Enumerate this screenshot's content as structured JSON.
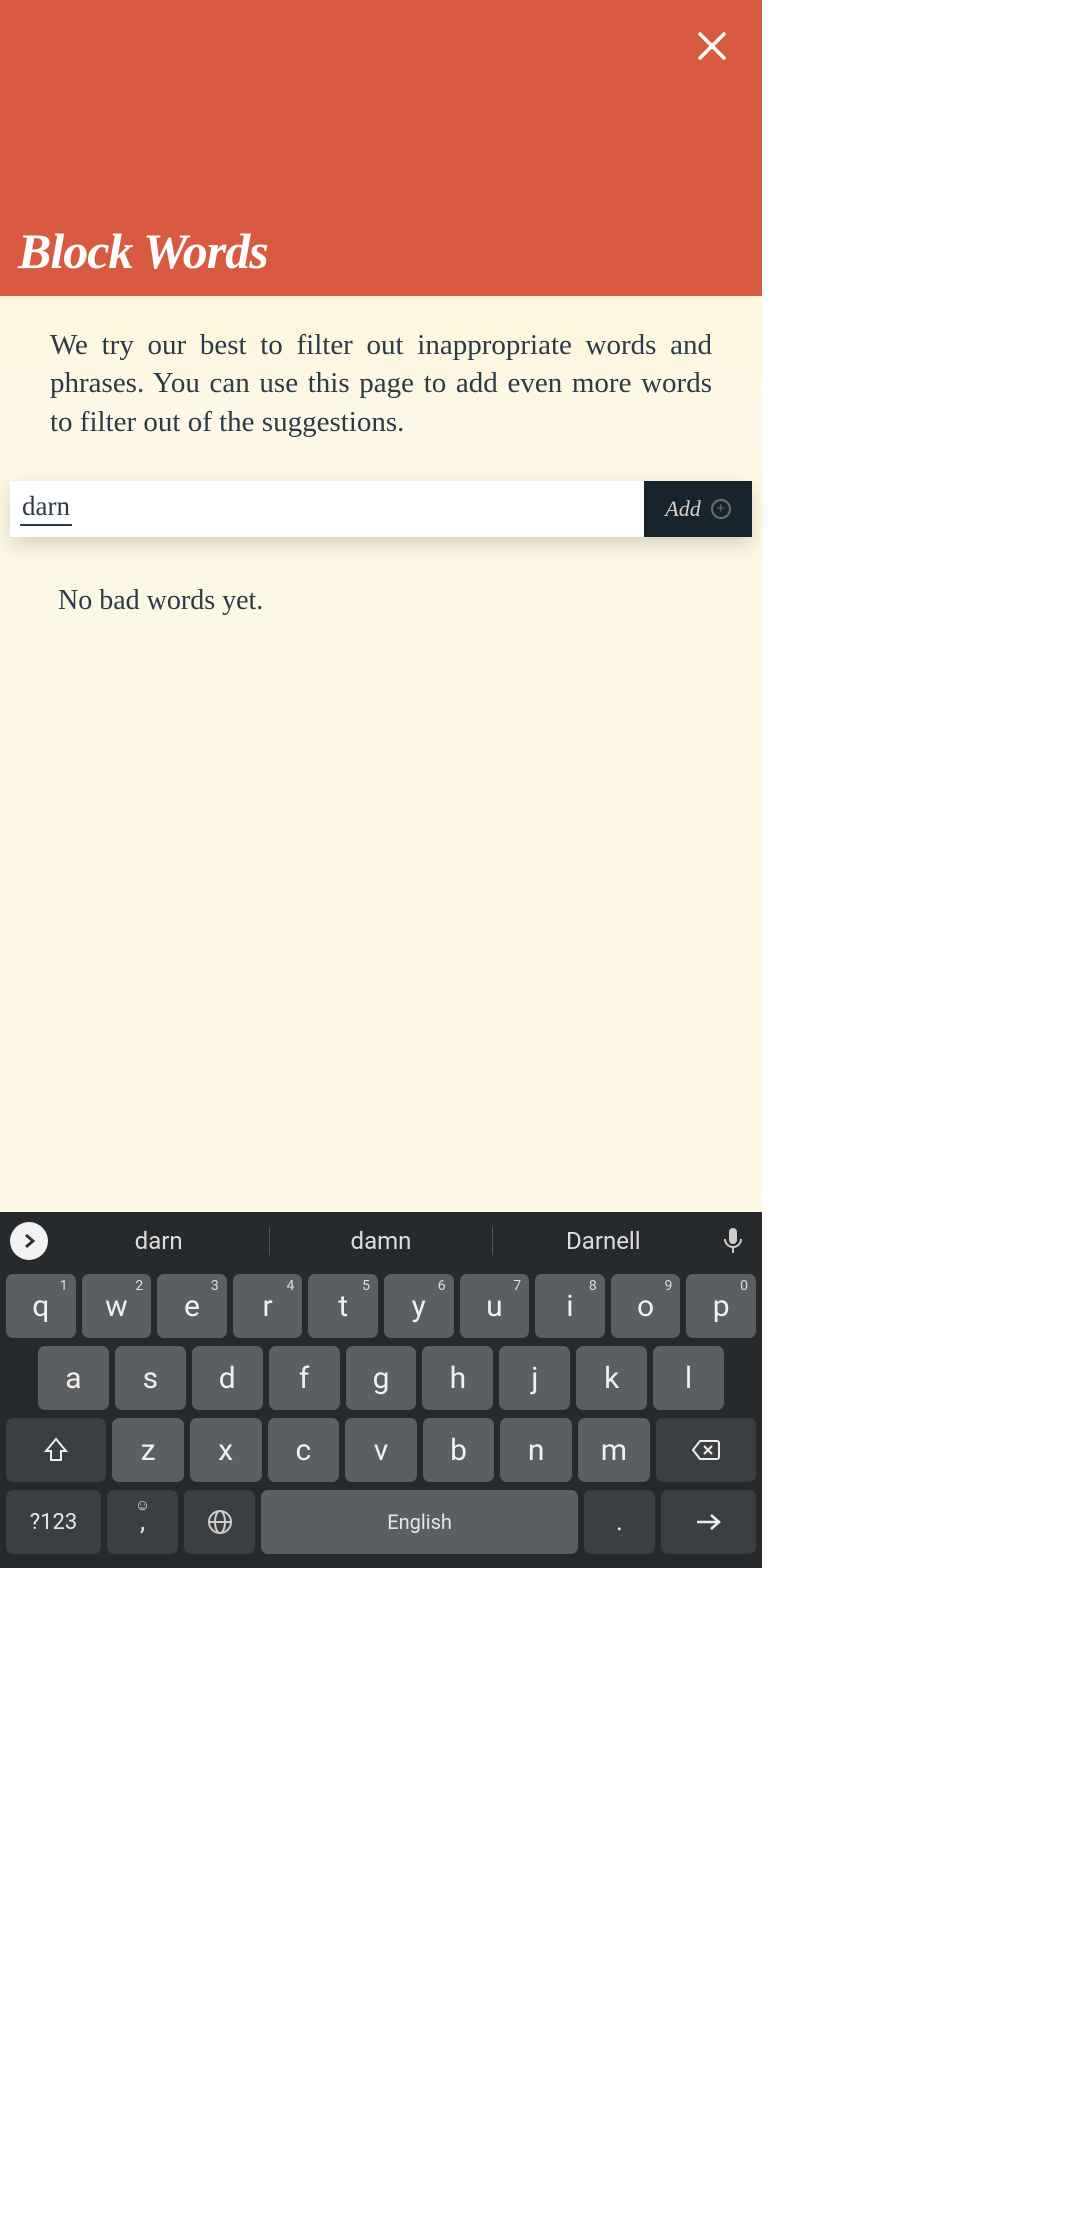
{
  "header": {
    "title": "Block Words"
  },
  "description": "We try our best to filter out inappropriate words and phrases. You can use this page to add even more words to filter out of the suggestions.",
  "input": {
    "value": "darn",
    "add_label": "Add"
  },
  "empty_state": "No bad words yet.",
  "keyboard": {
    "suggestions": [
      "darn",
      "damn",
      "Darnell"
    ],
    "row1": [
      {
        "k": "q",
        "n": "1"
      },
      {
        "k": "w",
        "n": "2"
      },
      {
        "k": "e",
        "n": "3"
      },
      {
        "k": "r",
        "n": "4"
      },
      {
        "k": "t",
        "n": "5"
      },
      {
        "k": "y",
        "n": "6"
      },
      {
        "k": "u",
        "n": "7"
      },
      {
        "k": "i",
        "n": "8"
      },
      {
        "k": "o",
        "n": "9"
      },
      {
        "k": "p",
        "n": "0"
      }
    ],
    "row2": [
      "a",
      "s",
      "d",
      "f",
      "g",
      "h",
      "j",
      "k",
      "l"
    ],
    "row3": [
      "z",
      "x",
      "c",
      "v",
      "b",
      "n",
      "m"
    ],
    "symbols_label": "?123",
    "space_label": "English",
    "comma": ",",
    "period": "."
  }
}
